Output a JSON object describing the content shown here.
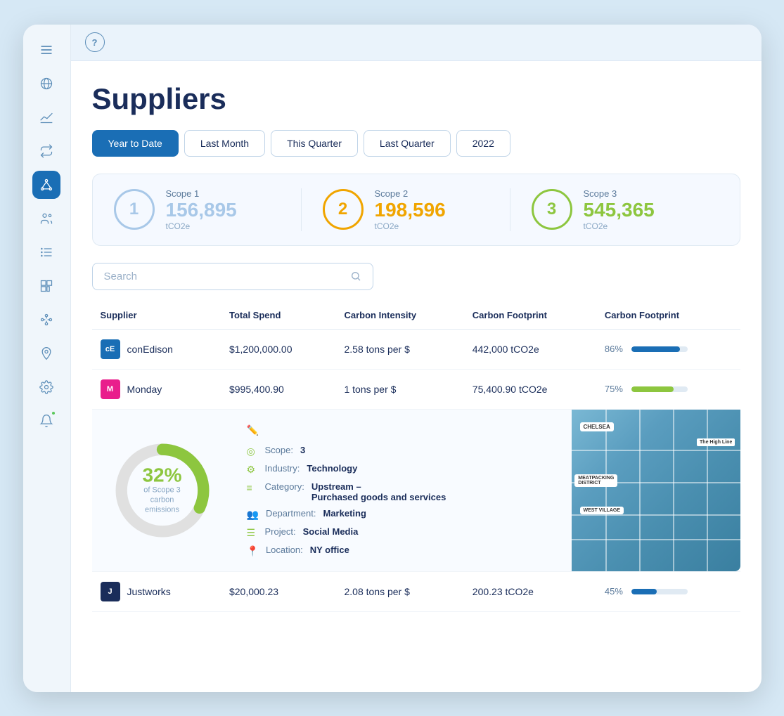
{
  "app": {
    "title": "Suppliers"
  },
  "topbar": {
    "help_label": "?"
  },
  "sidebar": {
    "items": [
      {
        "id": "menu",
        "icon": "menu",
        "active": false
      },
      {
        "id": "globe",
        "icon": "globe",
        "active": false
      },
      {
        "id": "chart",
        "icon": "chart",
        "active": false
      },
      {
        "id": "loop",
        "icon": "loop",
        "active": false
      },
      {
        "id": "network",
        "icon": "network",
        "active": true
      },
      {
        "id": "people",
        "icon": "people",
        "active": false
      },
      {
        "id": "list",
        "icon": "list",
        "active": false
      },
      {
        "id": "layout",
        "icon": "layout",
        "active": false
      },
      {
        "id": "connections",
        "icon": "connections",
        "active": false
      },
      {
        "id": "location",
        "icon": "location",
        "active": false
      },
      {
        "id": "settings",
        "icon": "settings",
        "active": false
      },
      {
        "id": "notifications",
        "icon": "notifications",
        "active": false
      }
    ]
  },
  "time_filters": [
    {
      "label": "Year to Date",
      "active": true
    },
    {
      "label": "Last Month",
      "active": false
    },
    {
      "label": "This Quarter",
      "active": false
    },
    {
      "label": "Last Quarter",
      "active": false
    },
    {
      "label": "2022",
      "active": false
    }
  ],
  "scope_cards": [
    {
      "scope_num": "1",
      "label": "Scope 1",
      "value": "156,895",
      "unit": "tCO2e",
      "color_class": "scope1"
    },
    {
      "scope_num": "2",
      "label": "Scope 2",
      "value": "198,596",
      "unit": "tCO2e",
      "color_class": "scope2"
    },
    {
      "scope_num": "3",
      "label": "Scope 3",
      "value": "545,365",
      "unit": "tCO2e",
      "color_class": "scope3"
    }
  ],
  "search": {
    "placeholder": "Search"
  },
  "table": {
    "headers": [
      "Supplier",
      "Total Spend",
      "Carbon Intensity",
      "Carbon Footprint",
      "Carbon Footprint"
    ],
    "rows": [
      {
        "name": "conEdison",
        "logo_color": "#1a6eb5",
        "logo_text": "cE",
        "total_spend": "$1,200,000.00",
        "carbon_intensity": "2.58 tons per $",
        "carbon_footprint": "442,000 tCO2e",
        "pct": "86",
        "bar_color": "blue"
      },
      {
        "name": "Monday",
        "logo_color": "#ff4081",
        "logo_text": "M",
        "total_spend": "$995,400.90",
        "carbon_intensity": "1 tons per $",
        "carbon_footprint": "75,400.90 tCO2e",
        "pct": "75",
        "bar_color": "green",
        "expanded": true
      },
      {
        "name": "Justworks",
        "logo_color": "#1a2d5a",
        "logo_text": "J",
        "total_spend": "$20,000.23",
        "carbon_intensity": "2.08 tons per $",
        "carbon_footprint": "200.23 tCO2e",
        "pct": "45",
        "bar_color": "blue"
      }
    ]
  },
  "expanded_detail": {
    "donut_pct": "32%",
    "donut_label": "of Scope 3\ncarbon emissions",
    "donut_value": 32,
    "details": [
      {
        "icon": "pencil",
        "label": "",
        "value": ""
      },
      {
        "icon": "scope",
        "label": "Scope: ",
        "value": "3"
      },
      {
        "icon": "industry",
        "label": "Industry: ",
        "value": "Technology"
      },
      {
        "icon": "category",
        "label": "Category: ",
        "value": "Upstream –\nPurchased goods and services"
      },
      {
        "icon": "dept",
        "label": "Department: ",
        "value": "Marketing"
      },
      {
        "icon": "project",
        "label": "Project: ",
        "value": "Social Media"
      },
      {
        "icon": "location",
        "label": "Location: ",
        "value": "NY office"
      }
    ]
  }
}
